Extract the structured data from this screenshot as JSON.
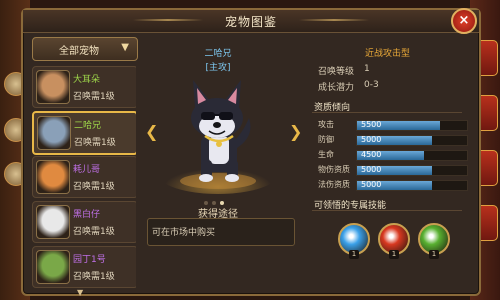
{
  "window": {
    "title": "宠物图鉴",
    "close_icon": "×"
  },
  "filter": {
    "label": "全部宠物"
  },
  "pets": [
    {
      "name": "大耳朵",
      "req": "召唤需1级",
      "name_color": "#9fd84a",
      "avatar_color": "#c89060"
    },
    {
      "name": "二哈兄",
      "req": "召唤需1级",
      "name_color": "#9fd84a",
      "avatar_color": "#8aa0b8",
      "selected": true
    },
    {
      "name": "耗儿哥",
      "req": "召唤需1级",
      "name_color": "#c070e8",
      "avatar_color": "#e08a40"
    },
    {
      "name": "黑白仔",
      "req": "召唤需1级",
      "name_color": "#c070e8",
      "avatar_color": "#e8e8e8"
    },
    {
      "name": "园丁1号",
      "req": "召唤需1级",
      "name_color": "#c070e8",
      "avatar_color": "#7aa848"
    }
  ],
  "preview": {
    "name": "二哈兄",
    "subtitle": "[主攻]",
    "carousel_pages": 3,
    "active_page": 3
  },
  "acquire": {
    "label": "获得途径",
    "text": "可在市场中购买"
  },
  "info": {
    "type": "近战攻击型",
    "level_label": "召唤等级",
    "level_value": "1",
    "growth_label": "成长潜力",
    "growth_value": "0-3",
    "aptitude_header": "资质倾向",
    "stats": [
      {
        "name": "攻击",
        "value": "5500",
        "fill": 0.75
      },
      {
        "name": "防御",
        "value": "5000",
        "fill": 0.68
      },
      {
        "name": "生命",
        "value": "4500",
        "fill": 0.61
      },
      {
        "name": "物伤资质",
        "value": "5000",
        "fill": 0.68
      },
      {
        "name": "法伤资质",
        "value": "5000",
        "fill": 0.68
      }
    ],
    "skills_header": "可领悟的专属技能",
    "skills": [
      {
        "icon": "blue-claw-skill-icon",
        "color": "#3aa0e8",
        "level": "1"
      },
      {
        "icon": "red-claw-skill-icon",
        "color": "#d83820",
        "level": "1"
      },
      {
        "icon": "green-claw-skill-icon",
        "color": "#58b030",
        "level": "1"
      }
    ]
  }
}
